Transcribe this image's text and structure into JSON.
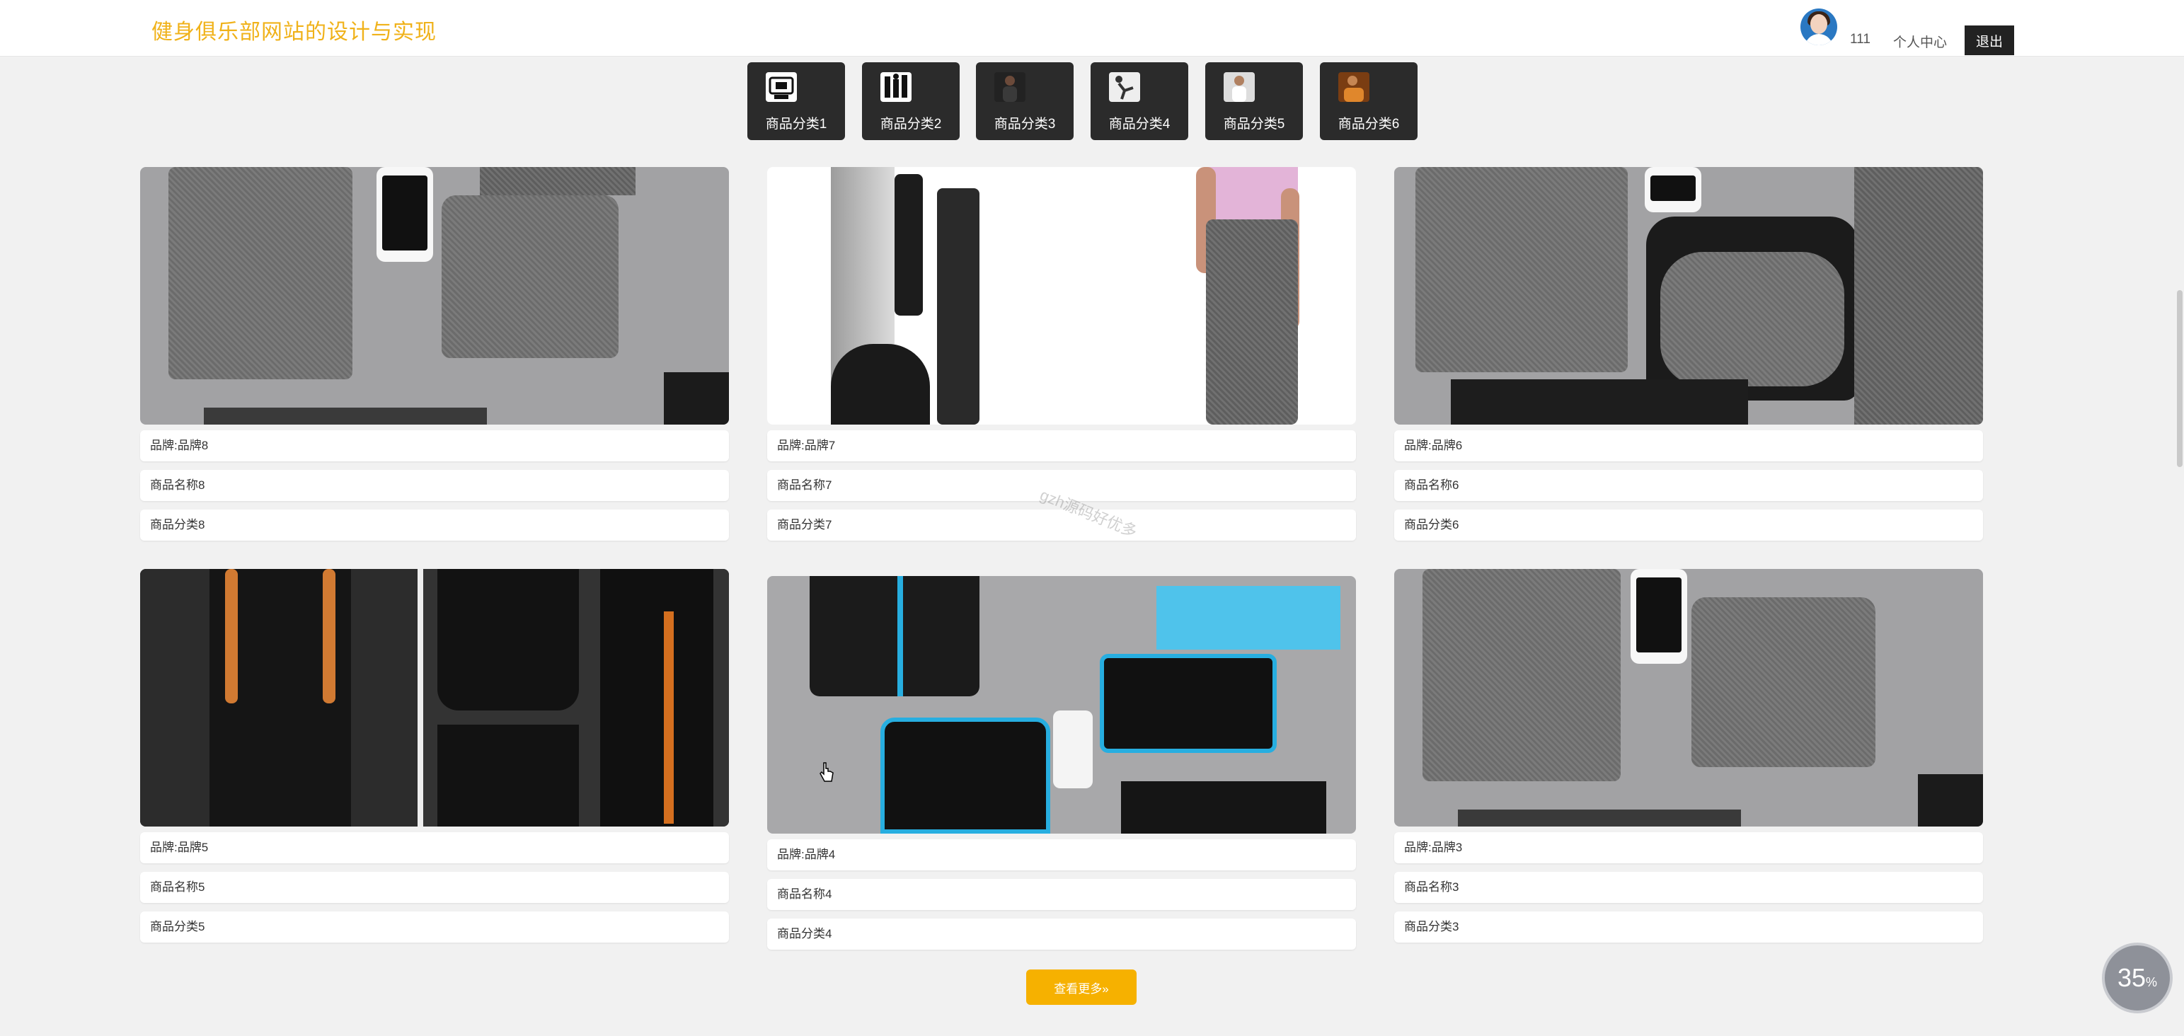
{
  "header": {
    "site_title": "健身俱乐部网站的设计与实现",
    "username": "111",
    "center_link": "个人中心",
    "logout_label": "退出"
  },
  "categories": [
    {
      "label": "商品分类1",
      "icon": "gym-equipment-icon"
    },
    {
      "label": "商品分类2",
      "icon": "fitness-tools-icon"
    },
    {
      "label": "商品分类3",
      "icon": "athlete-photo-icon"
    },
    {
      "label": "商品分类4",
      "icon": "exercise-figure-icon"
    },
    {
      "label": "商品分类5",
      "icon": "trainer-photo-icon"
    },
    {
      "label": "商品分类6",
      "icon": "boxing-photo-icon"
    }
  ],
  "products": [
    {
      "brand": "品牌:品牌8",
      "name": "商品名称8",
      "category": "商品分类8"
    },
    {
      "brand": "品牌:品牌7",
      "name": "商品名称7",
      "category": "商品分类7"
    },
    {
      "brand": "品牌:品牌6",
      "name": "商品名称6",
      "category": "商品分类6"
    },
    {
      "brand": "品牌:品牌5",
      "name": "商品名称5",
      "category": "商品分类5"
    },
    {
      "brand": "品牌:品牌4",
      "name": "商品名称4",
      "category": "商品分类4"
    },
    {
      "brand": "品牌:品牌3",
      "name": "商品名称3",
      "category": "商品分类3"
    }
  ],
  "more_button": "查看更多»",
  "watermark": "gzh源码好优多",
  "progress": {
    "value": "35",
    "unit": "%"
  },
  "colors": {
    "accent": "#f0b21a",
    "button": "#f6b100",
    "dark": "#2b2b2b"
  }
}
